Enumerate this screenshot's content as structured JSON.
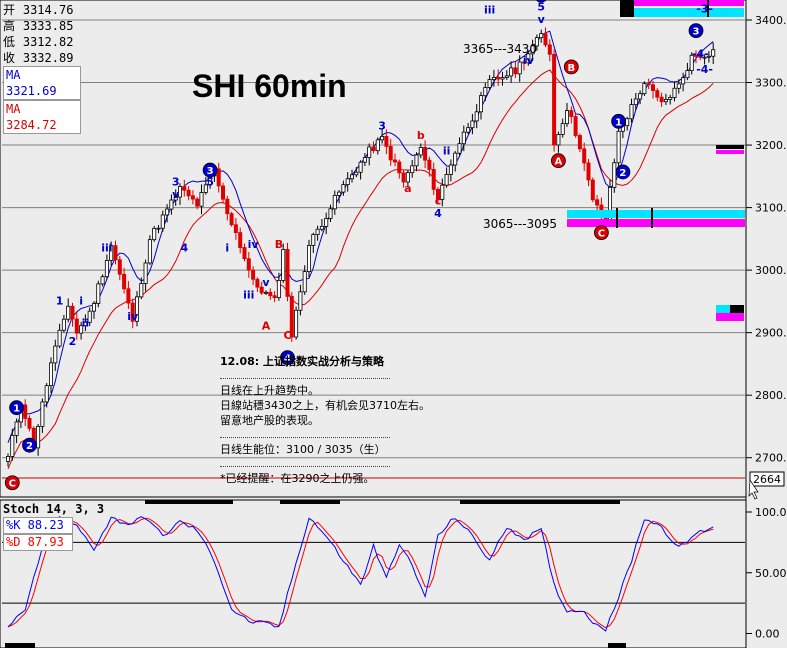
{
  "title": "SHI 60min",
  "info": {
    "rows": [
      {
        "label": "开",
        "value": "3314.76"
      },
      {
        "label": "高",
        "value": "3333.85"
      },
      {
        "label": "低",
        "value": "3312.82"
      },
      {
        "label": "收",
        "value": "3332.89"
      }
    ],
    "ma_short": "MA 3321.69",
    "ma_long": "MA 3284.72"
  },
  "price_axis_ticks": [
    "3400.",
    "3300.",
    "3200.",
    "3100.",
    "3000.",
    "2900.",
    "2800.",
    "2700."
  ],
  "price_marker": "2664",
  "stoch": {
    "header": "Stoch 14, 3, 3",
    "k_label": "%K  88.23",
    "d_label": "%D  87.93",
    "ticks": [
      "100.0",
      "50.00",
      "0.00"
    ]
  },
  "notes": [
    "12.08: 上证指数实战分析与策略",
    "日线在上升趋势中。",
    "日線站穩3430之上，有机会见3710左右。",
    "留意地产股的表现。",
    "日线生能位：3100 / 3035（生）",
    "*已经提醒：在3290之上仍强。"
  ],
  "chart_data": [
    {
      "type": "candlestick",
      "title": "SHI 60min",
      "ylim": [
        2640,
        3450
      ],
      "series": [
        {
          "name": "MA 3321.69",
          "color": "#0000cc"
        },
        {
          "name": "MA 3284.72",
          "color": "#dd0000"
        }
      ],
      "annotations": [
        {
          "text": "3365---3430",
          "price": 3430
        },
        {
          "text": "3065---3095",
          "price": 3095
        },
        {
          "text": "3",
          "price": 3365
        },
        {
          "text": "5",
          "price": 3380
        },
        {
          "text": "v",
          "price": 3365
        }
      ],
      "wave_labels": [
        "1",
        "2",
        "3",
        "4",
        "5",
        "i",
        "ii",
        "iii",
        "iv",
        "v",
        "A",
        "B",
        "C",
        "a",
        "b",
        "c",
        "-3-",
        "-4-"
      ]
    },
    {
      "type": "line",
      "title": "Stoch 14, 3, 3",
      "ylim": [
        0,
        100
      ],
      "series": [
        {
          "name": "%K  88.23",
          "color": "#0000ff",
          "last": 88.23
        },
        {
          "name": "%D  87.93",
          "color": "#ff0000",
          "last": 87.93
        }
      ]
    }
  ],
  "waves": [
    {
      "t": "1",
      "c": "blue",
      "circle": true,
      "i": 2,
      "p": 2780
    },
    {
      "t": "2",
      "c": "blue",
      "circle": true,
      "i": 5,
      "p": 2720
    },
    {
      "t": "C",
      "c": "red",
      "circle": true,
      "i": 1,
      "p": 2660
    },
    {
      "t": "1",
      "c": "blue",
      "i": 12,
      "p": 2945
    },
    {
      "t": "i",
      "c": "blue",
      "i": 17,
      "p": 2945
    },
    {
      "t": "ii",
      "c": "blue",
      "i": 18,
      "p": 2910
    },
    {
      "t": "2",
      "c": "blue",
      "i": 15,
      "p": 2880
    },
    {
      "t": "iii",
      "c": "blue",
      "i": 23,
      "p": 3030
    },
    {
      "t": "iv",
      "c": "blue",
      "i": 29,
      "p": 2920
    },
    {
      "t": "3",
      "c": "blue",
      "i": 39,
      "p": 3135
    },
    {
      "t": "v",
      "c": "blue",
      "i": 39,
      "p": 3115
    },
    {
      "t": "5",
      "c": "blue",
      "i": 47,
      "p": 3135
    },
    {
      "t": "3",
      "c": "blue",
      "circle": true,
      "i": 47,
      "p": 3160
    },
    {
      "t": "4",
      "c": "blue",
      "i": 41,
      "p": 3030
    },
    {
      "t": "i",
      "c": "blue",
      "i": 51,
      "p": 3030
    },
    {
      "t": "iv",
      "c": "blue",
      "i": 57,
      "p": 3035
    },
    {
      "t": "B",
      "c": "red",
      "i": 63,
      "p": 3035
    },
    {
      "t": "iii",
      "c": "blue",
      "i": 56,
      "p": 2955
    },
    {
      "t": "v",
      "c": "blue",
      "i": 60,
      "p": 2975
    },
    {
      "t": "A",
      "c": "red",
      "i": 60,
      "p": 2905
    },
    {
      "t": "C",
      "c": "red",
      "i": 65,
      "p": 2890
    },
    {
      "t": "4",
      "c": "blue",
      "circle": true,
      "i": 65,
      "p": 2860
    },
    {
      "t": "3",
      "c": "blue",
      "i": 87,
      "p": 3225
    },
    {
      "t": "b",
      "c": "red",
      "i": 96,
      "p": 3210
    },
    {
      "t": "a",
      "c": "red",
      "i": 93,
      "p": 3125
    },
    {
      "t": "c",
      "c": "red",
      "i": 100,
      "p": 3105
    },
    {
      "t": "4",
      "c": "blue",
      "i": 100,
      "p": 3085
    },
    {
      "t": "ii",
      "c": "blue",
      "i": 102,
      "p": 3185
    },
    {
      "t": "iii",
      "c": "blue",
      "i": 112,
      "p": 3410
    },
    {
      "t": "iv",
      "c": "blue",
      "i": 121,
      "p": 3330
    },
    {
      "t": "5",
      "c": "blue",
      "circle": true,
      "i": 124,
      "p": 3440
    },
    {
      "t": "5",
      "c": "blue",
      "i": 124,
      "p": 3415
    },
    {
      "t": "v",
      "c": "blue",
      "i": 124,
      "p": 3395
    },
    {
      "t": "B",
      "c": "red",
      "circle": true,
      "i": 131,
      "p": 3325
    },
    {
      "t": "A",
      "c": "red",
      "circle": true,
      "i": 128,
      "p": 3175
    },
    {
      "t": "1",
      "c": "blue",
      "circle": true,
      "i": 142,
      "p": 3238
    },
    {
      "t": "2",
      "c": "blue",
      "circle": true,
      "i": 143,
      "p": 3157
    },
    {
      "t": "C",
      "c": "red",
      "circle": true,
      "i": 138,
      "p": 3060
    },
    {
      "t": "3",
      "c": "blue",
      "circle": true,
      "i": 160,
      "p": 3383
    },
    {
      "t": "-3-",
      "c": "blue",
      "i": 162,
      "p": 3412
    },
    {
      "t": "-4-",
      "c": "blue",
      "i": 161,
      "p": 3340
    },
    {
      "t": "-4-",
      "c": "blue",
      "i": 162,
      "p": 3315
    }
  ]
}
